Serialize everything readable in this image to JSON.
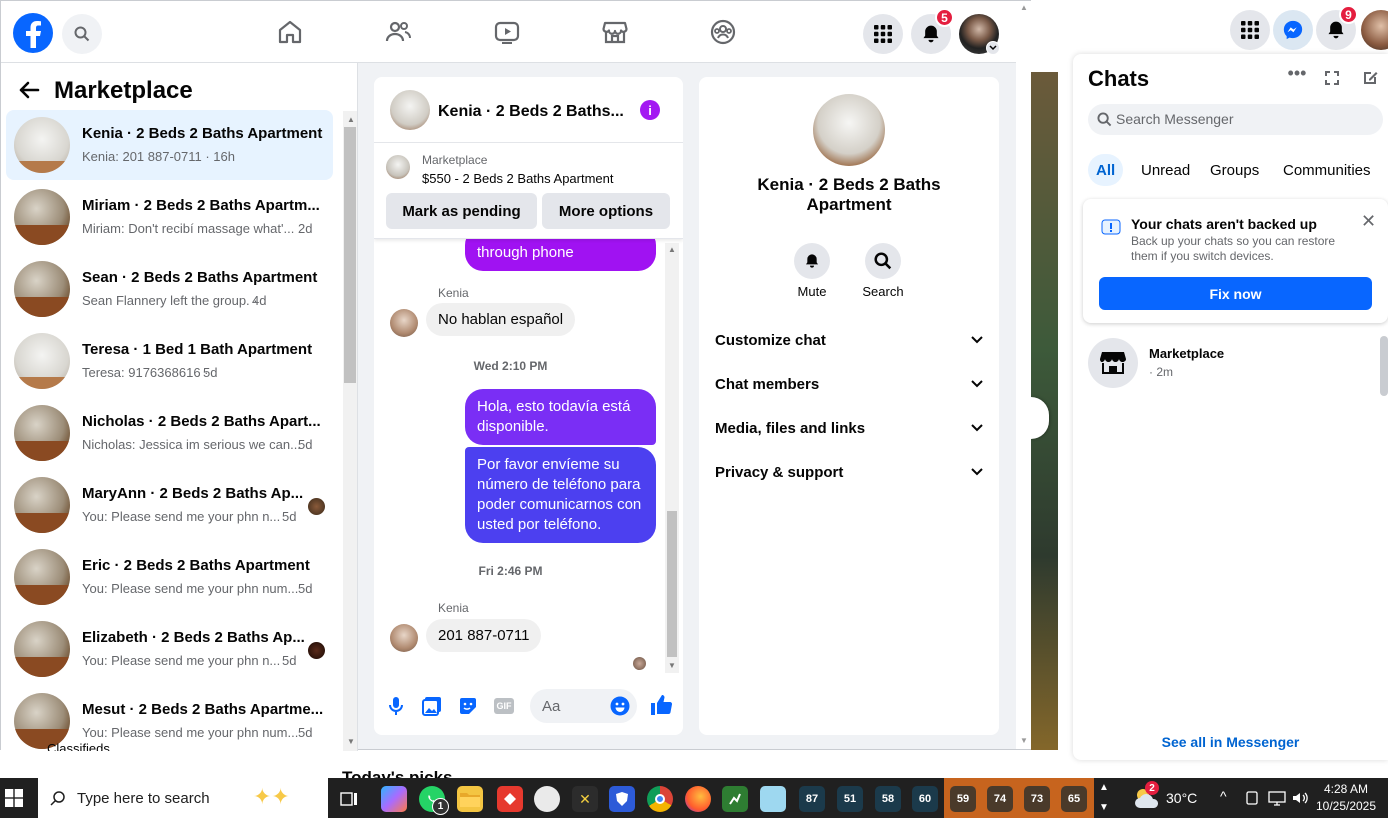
{
  "top_nav": {
    "notifications_badge": "5"
  },
  "marketplace": {
    "title": "Marketplace",
    "conversations": [
      {
        "title": "Kenia · 2 Beds 2 Baths Apartment",
        "preview": "Kenia: 201 887-0711 · 16h",
        "time": ""
      },
      {
        "title": "Miriam · 2 Beds 2 Baths Apartm...",
        "preview": "Miriam: Don't recibí massage what'...",
        "time": "2d"
      },
      {
        "title": "Sean · 2 Beds 2 Baths Apartment",
        "preview": "Sean Flannery left the group. ·",
        "time": "4d"
      },
      {
        "title": "Teresa · 1 Bed 1 Bath Apartment",
        "preview": "Teresa: 9176368616 ·",
        "time": "5d"
      },
      {
        "title": "Nicholas · 2 Beds 2 Baths Apart...",
        "preview": "Nicholas: Jessica im serious we can...",
        "time": "5d"
      },
      {
        "title": "MaryAnn · 2 Beds 2 Baths Ap...",
        "preview": "You: Please send me your phn n...",
        "time": "5d"
      },
      {
        "title": "Eric · 2 Beds 2 Baths Apartment",
        "preview": "You: Please send me your phn num...",
        "time": "5d"
      },
      {
        "title": "Elizabeth · 2 Beds 2 Baths Ap...",
        "preview": "You: Please send me your phn n...",
        "time": "5d"
      },
      {
        "title": "Mesut · 2 Beds 2 Baths Apartme...",
        "preview": "You: Please send me your phn num...",
        "time": "5d"
      }
    ],
    "footer_partial": "Classifieds"
  },
  "chat": {
    "header_title": "Kenia · 2 Beds 2 Baths...",
    "listing_source": "Marketplace",
    "listing_title": "$550 - 2 Beds 2 Baths Apartment",
    "mark_pending": "Mark as pending",
    "more_options": "More options",
    "msg_out_partial": "through phone",
    "sender1": "Kenia",
    "msg_in_1": "No hablan español",
    "time_1": "Wed 2:10 PM",
    "msg_out_1": "Hola, esto todavía está disponible.",
    "msg_out_2": "Por favor envíeme su número de teléfono para poder comunicarnos con usted por teléfono.",
    "time_2": "Fri 2:46 PM",
    "sender2": "Kenia",
    "msg_in_2": "201 887-0711",
    "composer_placeholder": "Aa"
  },
  "info": {
    "name": "Kenia · 2 Beds 2 Baths Apartment",
    "mute": "Mute",
    "search": "Search",
    "sections": [
      "Customize chat",
      "Chat members",
      "Media, files and links",
      "Privacy & support"
    ]
  },
  "chats": {
    "title": "Chats",
    "search_placeholder": "Search Messenger",
    "tabs": [
      "All",
      "Unread",
      "Groups",
      "Communities"
    ],
    "notif_badge": "9",
    "backup_title": "Your chats aren't backed up",
    "backup_body": "Back up your chats so you can restore them if you switch devices.",
    "fix_now": "Fix now",
    "thread_name": "Marketplace",
    "thread_time": "· 2m",
    "see_all": "See all in Messenger"
  },
  "page_partial": {
    "picks": "Today's picks"
  },
  "taskbar": {
    "search_placeholder": "Type here to search",
    "weather": "30°C",
    "weather_badge": "2",
    "time": "4:28 AM",
    "date": "10/25/2025",
    "whatsapp_badge": "1",
    "apps": [
      "87",
      "51",
      "58",
      "60",
      "59",
      "74",
      "73",
      "65"
    ]
  },
  "colors": {
    "fb_blue": "#0866ff",
    "purple_bubble": "#7b2ff7",
    "badge_red": "#e41e3f"
  }
}
